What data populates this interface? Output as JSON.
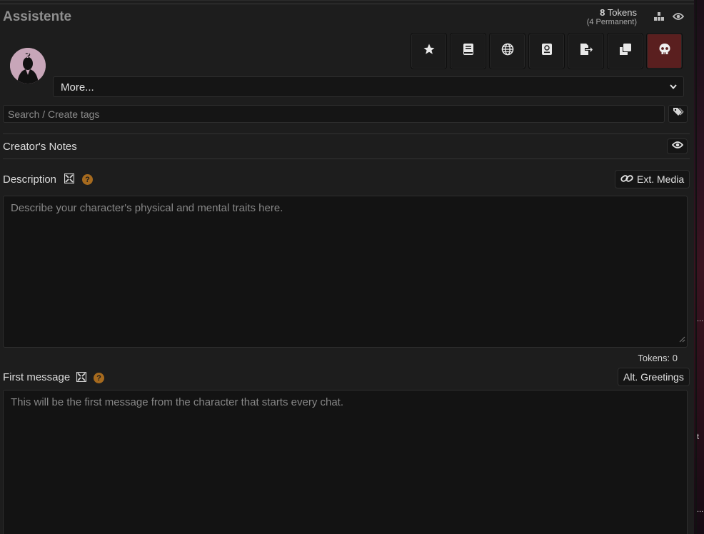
{
  "header": {
    "title": "Assistente",
    "tokens_count": "8",
    "tokens_label": "Tokens",
    "tokens_permanent": "(4 Permanent)"
  },
  "icons": {
    "stats": "chart-bars-icon",
    "eye": "eye-icon",
    "favorite": "star-icon",
    "lore_book": "book-icon",
    "world_info": "globe-icon",
    "chat_lore": "passport-icon",
    "export": "file-export-icon",
    "duplicate": "clone-icon",
    "delete": "skull-icon",
    "tag": "tags-icon",
    "link": "link-icon",
    "expand": "expand-icon",
    "help": "question-icon"
  },
  "more_select": {
    "value": "More..."
  },
  "tags": {
    "placeholder": "Search / Create tags"
  },
  "creators_notes": {
    "label": "Creator's Notes"
  },
  "description": {
    "label": "Description",
    "help": "?",
    "ext_media_label": "Ext. Media",
    "placeholder": "Describe your character's physical and mental traits here.",
    "tokens": "Tokens: 0"
  },
  "first_message": {
    "label": "First message",
    "help": "?",
    "alt_greetings_label": "Alt. Greetings",
    "placeholder": "This will be the first message from the character that starts every chat."
  },
  "edge_marks": [
    "...",
    "t",
    "..."
  ],
  "colors": {
    "danger": "#5a1f1f",
    "help": "#a66a1e",
    "background": "#1d1d1d"
  }
}
